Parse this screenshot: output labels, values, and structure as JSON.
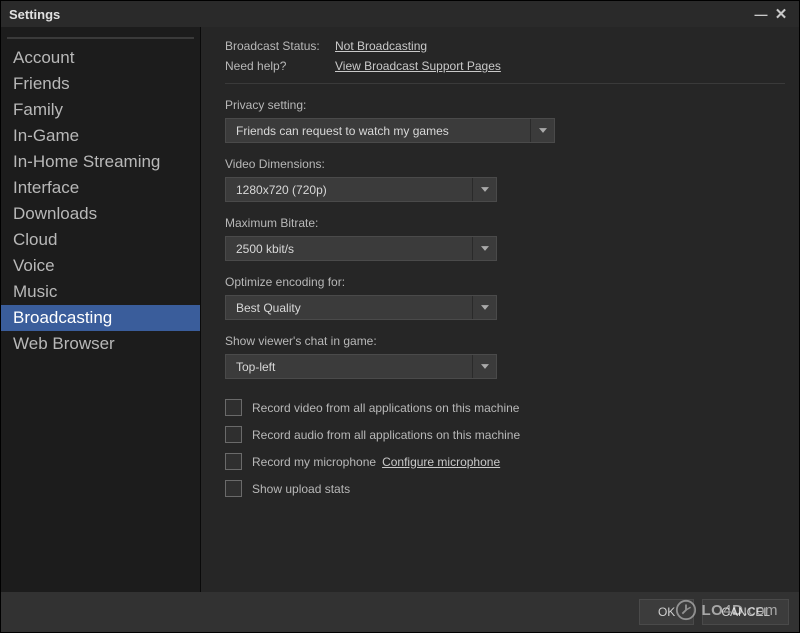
{
  "window": {
    "title": "Settings"
  },
  "sidebar": {
    "items": [
      {
        "label": "Account",
        "selected": false
      },
      {
        "label": "Friends",
        "selected": false
      },
      {
        "label": "Family",
        "selected": false
      },
      {
        "label": "In-Game",
        "selected": false
      },
      {
        "label": "In-Home Streaming",
        "selected": false
      },
      {
        "label": "Interface",
        "selected": false
      },
      {
        "label": "Downloads",
        "selected": false
      },
      {
        "label": "Cloud",
        "selected": false
      },
      {
        "label": "Voice",
        "selected": false
      },
      {
        "label": "Music",
        "selected": false
      },
      {
        "label": "Broadcasting",
        "selected": true
      },
      {
        "label": "Web Browser",
        "selected": false
      }
    ]
  },
  "main": {
    "status_label": "Broadcast Status:",
    "status_value": "Not Broadcasting",
    "help_label": "Need help?",
    "help_link": "View Broadcast Support Pages",
    "privacy": {
      "label": "Privacy setting:",
      "value": "Friends can request to watch my games"
    },
    "dimensions": {
      "label": "Video Dimensions:",
      "value": "1280x720 (720p)"
    },
    "bitrate": {
      "label": "Maximum Bitrate:",
      "value": "2500 kbit/s"
    },
    "encoding": {
      "label": "Optimize encoding for:",
      "value": "Best Quality"
    },
    "chat_pos": {
      "label": "Show viewer's chat in game:",
      "value": "Top-left"
    },
    "checks": {
      "record_video": {
        "label": "Record video from all applications on this machine",
        "checked": false
      },
      "record_audio": {
        "label": "Record audio from all applications on this machine",
        "checked": false
      },
      "record_mic": {
        "label": "Record my microphone",
        "checked": false,
        "link": "Configure microphone"
      },
      "upload_stats": {
        "label": "Show upload stats",
        "checked": false
      }
    }
  },
  "footer": {
    "ok": "OK",
    "cancel": "CANCEL"
  },
  "watermark": {
    "text_a": "LO",
    "text_b": "4",
    "text_c": "D",
    "text_d": ".com"
  }
}
